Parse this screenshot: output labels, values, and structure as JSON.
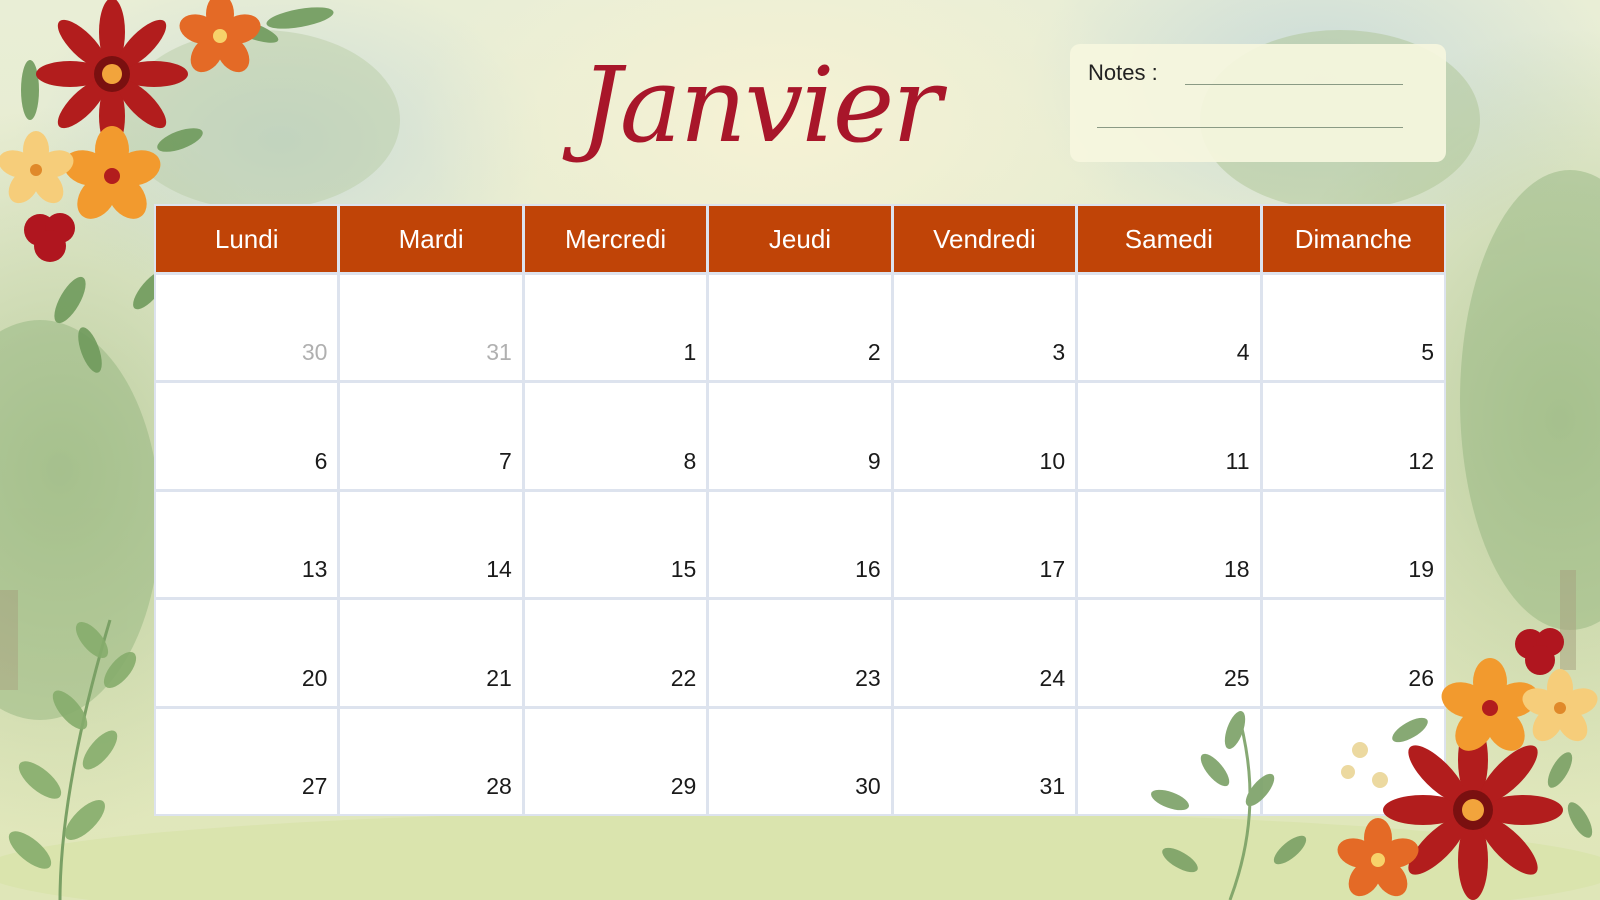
{
  "page": {
    "title": "Janvier",
    "notes_label": "Notes :"
  },
  "colors": {
    "header_bg": "#c04407",
    "title_color": "#a8162a",
    "grid_line": "#dde3ee",
    "outside_day": "#b0b0b0"
  },
  "calendar": {
    "weekdays": [
      "Lundi",
      "Mardi",
      "Mercredi",
      "Jeudi",
      "Vendredi",
      "Samedi",
      "Dimanche"
    ],
    "weeks": [
      [
        {
          "d": "30",
          "outside": true
        },
        {
          "d": "31",
          "outside": true
        },
        {
          "d": "1"
        },
        {
          "d": "2"
        },
        {
          "d": "3"
        },
        {
          "d": "4"
        },
        {
          "d": "5"
        }
      ],
      [
        {
          "d": "6"
        },
        {
          "d": "7"
        },
        {
          "d": "8"
        },
        {
          "d": "9"
        },
        {
          "d": "10"
        },
        {
          "d": "11"
        },
        {
          "d": "12"
        }
      ],
      [
        {
          "d": "13"
        },
        {
          "d": "14"
        },
        {
          "d": "15"
        },
        {
          "d": "16"
        },
        {
          "d": "17"
        },
        {
          "d": "18"
        },
        {
          "d": "19"
        }
      ],
      [
        {
          "d": "20"
        },
        {
          "d": "21"
        },
        {
          "d": "22"
        },
        {
          "d": "23"
        },
        {
          "d": "24"
        },
        {
          "d": "25"
        },
        {
          "d": "26"
        }
      ],
      [
        {
          "d": "27"
        },
        {
          "d": "28"
        },
        {
          "d": "29"
        },
        {
          "d": "30"
        },
        {
          "d": "31"
        },
        {
          "d": ""
        },
        {
          "d": ""
        }
      ]
    ]
  },
  "decorations": [
    "flower-cluster-icon",
    "leaf-branch-icon"
  ]
}
